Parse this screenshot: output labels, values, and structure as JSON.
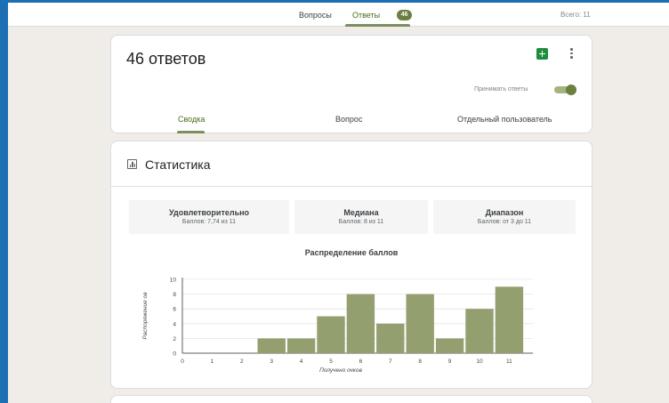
{
  "nav": {
    "questions_label": "Вопросы",
    "answers_label": "Ответы",
    "answers_count": "46",
    "total_label": "Всего: 11"
  },
  "responses": {
    "title": "46 ответов",
    "accept_label": "Принимать ответы",
    "accept_enabled": true,
    "tabs": [
      {
        "label": "Сводка",
        "active": true
      },
      {
        "label": "Вопрос",
        "active": false
      },
      {
        "label": "Отдельный пользователь",
        "active": false
      }
    ]
  },
  "stats": {
    "title": "Статистика",
    "cards": [
      {
        "title": "Удовлетворительно",
        "value": "Баллов: 7,74 из 11"
      },
      {
        "title": "Медиана",
        "value": "Баллов: 8 из 11"
      },
      {
        "title": "Диапазон",
        "value": "Баллов: от 3 до 11"
      }
    ]
  },
  "chart_data": {
    "type": "bar",
    "title": "Распределение баллов",
    "xlabel": "Получено очков",
    "ylabel": "Распоряжение ов",
    "categories": [
      "0",
      "1",
      "2",
      "3",
      "4",
      "5",
      "6",
      "7",
      "8",
      "9",
      "10",
      "11"
    ],
    "values": [
      0,
      0,
      0,
      2,
      2,
      5,
      8,
      4,
      8,
      2,
      6,
      9
    ],
    "ylim": [
      0,
      10
    ],
    "yticks": [
      0,
      2,
      4,
      6,
      8,
      10
    ],
    "grid": true,
    "bar_color": "#949f6f"
  },
  "colors": {
    "accent": "#6c7f3f",
    "frame": "#1d6fb4",
    "sheets": "#1e8e3e"
  }
}
